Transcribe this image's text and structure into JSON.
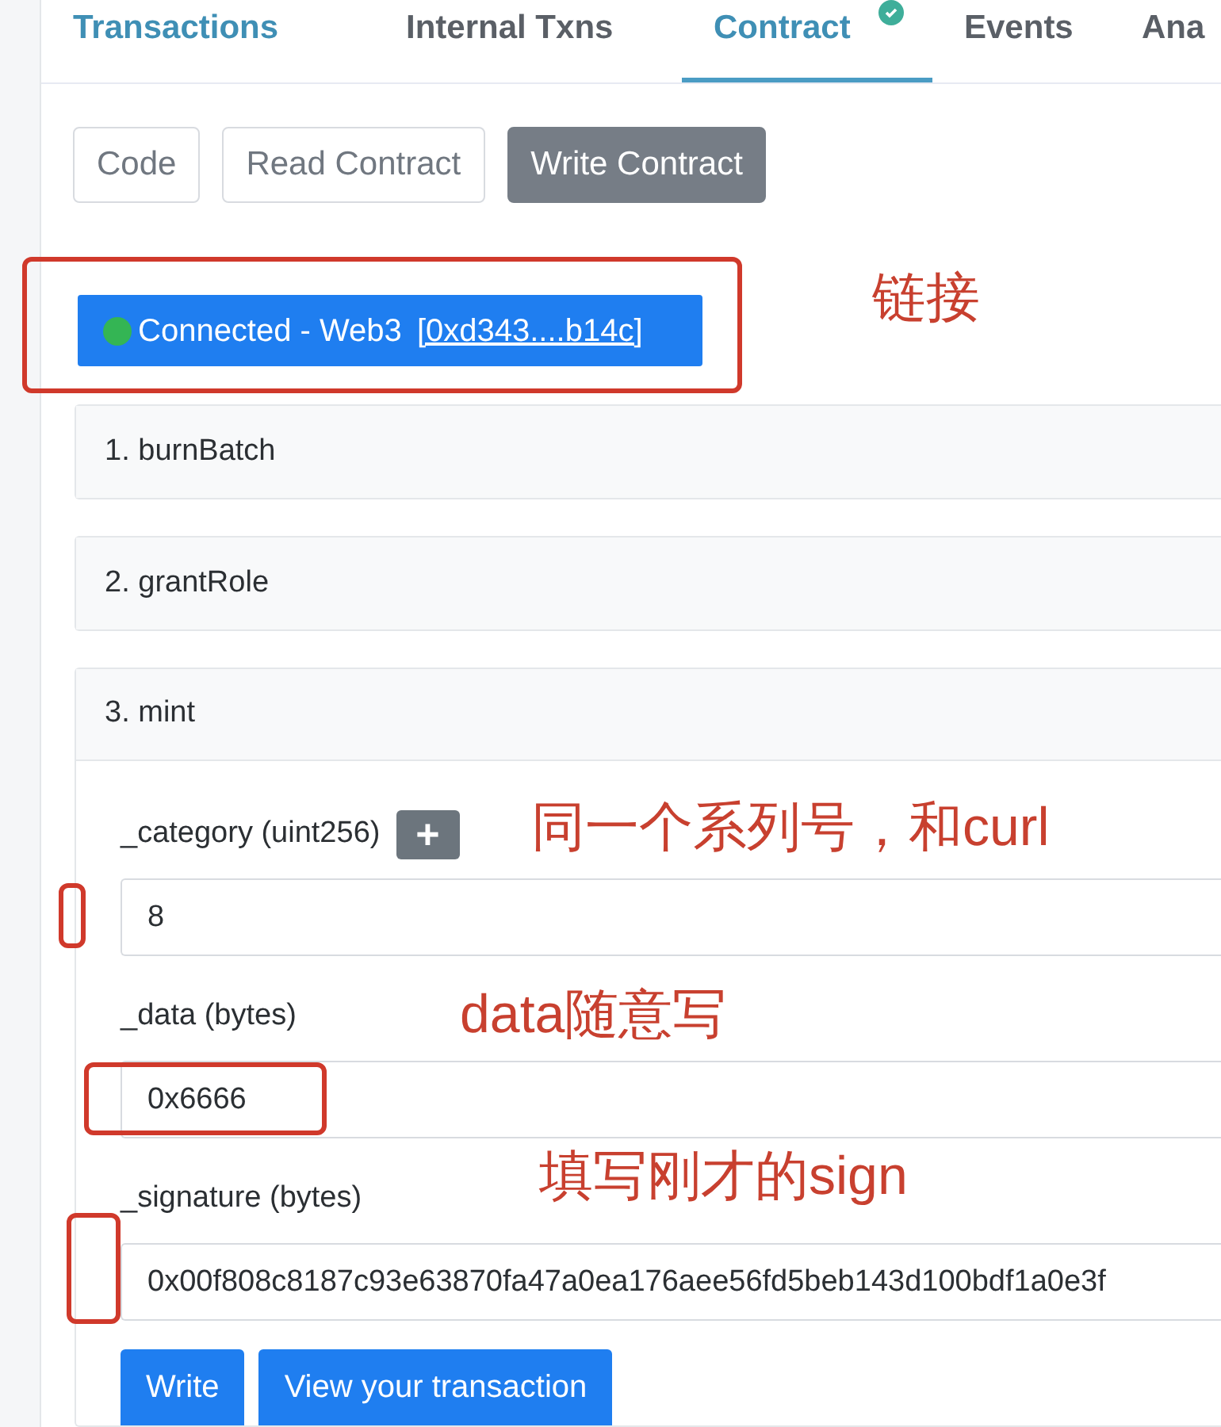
{
  "tabs": [
    {
      "label": "Transactions",
      "selected": false,
      "hover": true,
      "verified": false
    },
    {
      "label": "Internal Txns",
      "selected": false,
      "hover": false,
      "verified": false
    },
    {
      "label": "Contract",
      "selected": true,
      "hover": false,
      "verified": true
    },
    {
      "label": "Events",
      "selected": false,
      "hover": false,
      "verified": false
    },
    {
      "label": "Ana",
      "selected": false,
      "hover": false,
      "verified": false
    }
  ],
  "sub_tabs": [
    {
      "label": "Code",
      "selected": false
    },
    {
      "label": "Read Contract",
      "selected": false
    },
    {
      "label": "Write Contract",
      "selected": true
    }
  ],
  "connection": {
    "connected": true,
    "label": "Connected - Web3 ",
    "address": "[0xd343....b14c]"
  },
  "functions": [
    {
      "title": "1. burnBatch",
      "expanded": false
    },
    {
      "title": "2. grantRole",
      "expanded": false
    },
    {
      "title": "3. mint",
      "expanded": true,
      "params": [
        {
          "label": "_category (uint256)",
          "add_button": "+",
          "value": "8"
        },
        {
          "label": "_data (bytes)",
          "value": "0x6666"
        },
        {
          "label": "_signature (bytes)",
          "value": "0x00f808c8187c93e63870fa47a0ea176aee56fd5beb143d100bdf1a0e3f"
        }
      ],
      "buttons": [
        "Write",
        "View your transaction"
      ]
    }
  ],
  "annotations": [
    "链接",
    "同一个系列号，和curl",
    "data随意写",
    "填写刚才的sign"
  ]
}
